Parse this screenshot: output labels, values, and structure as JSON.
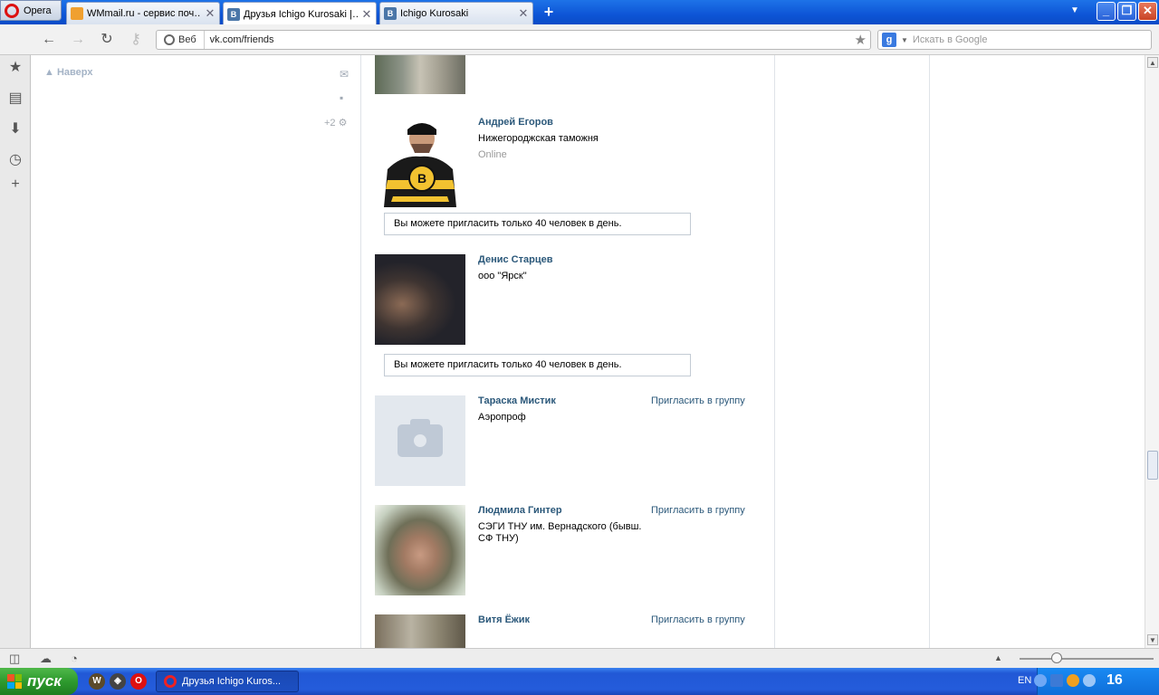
{
  "browser": {
    "menu_label": "Opera",
    "tabs": [
      {
        "title": "WMmail.ru - сервис поч…"
      },
      {
        "title": "Друзья Ichigo Kurosaki |…"
      },
      {
        "title": "Ichigo Kurosaki"
      }
    ],
    "web_label": "Веб",
    "url": "vk.com/friends",
    "search_placeholder": "Искать в Google"
  },
  "page": {
    "back_to_top": "Наверх",
    "plus_count": "+2",
    "notice_text": "Вы можете пригласить только 40 человек в день.",
    "friends": [
      {
        "name": "Андрей Егоров",
        "info": "Нижегороджская таможня",
        "status": "Online"
      },
      {
        "name": "Денис Старцев",
        "info": "ооо \"Ярск\""
      },
      {
        "name": "Тараска Мистик",
        "info": "Аэропроф",
        "invite": "Пригласить в группу"
      },
      {
        "name": "Людмила Гинтер",
        "info": "СЭГИ ТНУ им. Вернадского (бывш. СФ ТНУ)",
        "invite": "Пригласить в группу"
      },
      {
        "name": "Витя Ёжик",
        "invite": "Пригласить в группу"
      }
    ]
  },
  "taskbar": {
    "start_label": "пуск",
    "task_title": "Друзья Ichigo Kuros...",
    "lang": "EN",
    "clock": "16"
  },
  "colors": {
    "vk_link": "#2b587a",
    "tabbar": "#0d55d6",
    "start_green": "#2e9a2e"
  }
}
